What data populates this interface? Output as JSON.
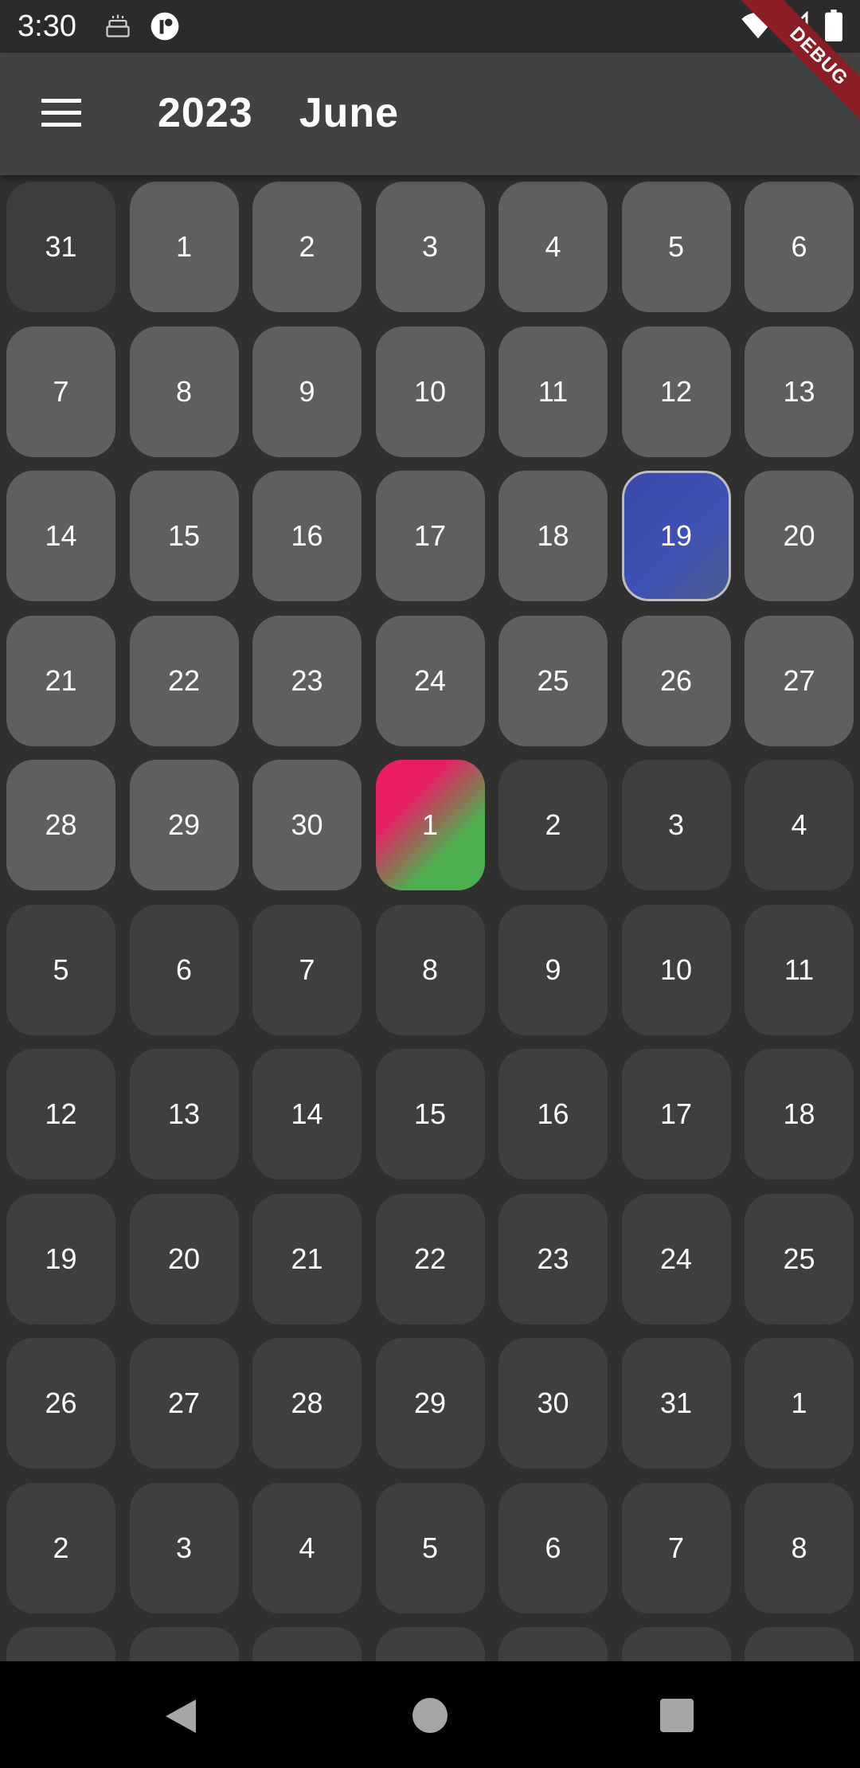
{
  "status_bar": {
    "time": "3:30",
    "icons": [
      "cake-icon",
      "app-notification-icon",
      "wifi-icon",
      "signal-icon",
      "battery-icon"
    ]
  },
  "app_bar": {
    "menu_icon": "hamburger-menu-icon",
    "year": "2023",
    "month": "June"
  },
  "debug_banner": "DEBUG",
  "colors": {
    "background": "#303030",
    "app_bar": "#424242",
    "current_month_cell": "#5f5f5f",
    "other_month_cell": "#3e3e3e",
    "selected_gradient": [
      "#3949ab",
      "#4b5a8e"
    ],
    "today_gradient": [
      "#e91e63",
      "#4caf50"
    ]
  },
  "calendar": {
    "weeks": [
      [
        {
          "d": "31",
          "t": "prev"
        },
        {
          "d": "1",
          "t": "cur"
        },
        {
          "d": "2",
          "t": "cur"
        },
        {
          "d": "3",
          "t": "cur"
        },
        {
          "d": "4",
          "t": "cur"
        },
        {
          "d": "5",
          "t": "cur"
        },
        {
          "d": "6",
          "t": "cur"
        }
      ],
      [
        {
          "d": "7",
          "t": "cur"
        },
        {
          "d": "8",
          "t": "cur"
        },
        {
          "d": "9",
          "t": "cur"
        },
        {
          "d": "10",
          "t": "cur"
        },
        {
          "d": "11",
          "t": "cur"
        },
        {
          "d": "12",
          "t": "cur"
        },
        {
          "d": "13",
          "t": "cur"
        }
      ],
      [
        {
          "d": "14",
          "t": "cur"
        },
        {
          "d": "15",
          "t": "cur"
        },
        {
          "d": "16",
          "t": "cur"
        },
        {
          "d": "17",
          "t": "cur"
        },
        {
          "d": "18",
          "t": "cur"
        },
        {
          "d": "19",
          "t": "selected"
        },
        {
          "d": "20",
          "t": "cur"
        }
      ],
      [
        {
          "d": "21",
          "t": "cur"
        },
        {
          "d": "22",
          "t": "cur"
        },
        {
          "d": "23",
          "t": "cur"
        },
        {
          "d": "24",
          "t": "cur"
        },
        {
          "d": "25",
          "t": "cur"
        },
        {
          "d": "26",
          "t": "cur"
        },
        {
          "d": "27",
          "t": "cur"
        }
      ],
      [
        {
          "d": "28",
          "t": "cur"
        },
        {
          "d": "29",
          "t": "cur"
        },
        {
          "d": "30",
          "t": "cur"
        },
        {
          "d": "1",
          "t": "today"
        },
        {
          "d": "2",
          "t": "next"
        },
        {
          "d": "3",
          "t": "next"
        },
        {
          "d": "4",
          "t": "next"
        }
      ],
      [
        {
          "d": "5",
          "t": "next"
        },
        {
          "d": "6",
          "t": "next"
        },
        {
          "d": "7",
          "t": "next"
        },
        {
          "d": "8",
          "t": "next"
        },
        {
          "d": "9",
          "t": "next"
        },
        {
          "d": "10",
          "t": "next"
        },
        {
          "d": "11",
          "t": "next"
        }
      ],
      [
        {
          "d": "12",
          "t": "next"
        },
        {
          "d": "13",
          "t": "next"
        },
        {
          "d": "14",
          "t": "next"
        },
        {
          "d": "15",
          "t": "next"
        },
        {
          "d": "16",
          "t": "next"
        },
        {
          "d": "17",
          "t": "next"
        },
        {
          "d": "18",
          "t": "next"
        }
      ],
      [
        {
          "d": "19",
          "t": "next"
        },
        {
          "d": "20",
          "t": "next"
        },
        {
          "d": "21",
          "t": "next"
        },
        {
          "d": "22",
          "t": "next"
        },
        {
          "d": "23",
          "t": "next"
        },
        {
          "d": "24",
          "t": "next"
        },
        {
          "d": "25",
          "t": "next"
        }
      ],
      [
        {
          "d": "26",
          "t": "next"
        },
        {
          "d": "27",
          "t": "next"
        },
        {
          "d": "28",
          "t": "next"
        },
        {
          "d": "29",
          "t": "next"
        },
        {
          "d": "30",
          "t": "next"
        },
        {
          "d": "31",
          "t": "next"
        },
        {
          "d": "1",
          "t": "next"
        }
      ],
      [
        {
          "d": "2",
          "t": "next"
        },
        {
          "d": "3",
          "t": "next"
        },
        {
          "d": "4",
          "t": "next"
        },
        {
          "d": "5",
          "t": "next"
        },
        {
          "d": "6",
          "t": "next"
        },
        {
          "d": "7",
          "t": "next"
        },
        {
          "d": "8",
          "t": "next"
        }
      ],
      [
        {
          "d": "",
          "t": "next"
        },
        {
          "d": "",
          "t": "next"
        },
        {
          "d": "",
          "t": "next"
        },
        {
          "d": "",
          "t": "next"
        },
        {
          "d": "",
          "t": "next"
        },
        {
          "d": "",
          "t": "next"
        },
        {
          "d": "",
          "t": "next"
        }
      ]
    ]
  },
  "nav_bar": {
    "icons": [
      "back-icon",
      "home-icon",
      "recents-icon"
    ]
  }
}
